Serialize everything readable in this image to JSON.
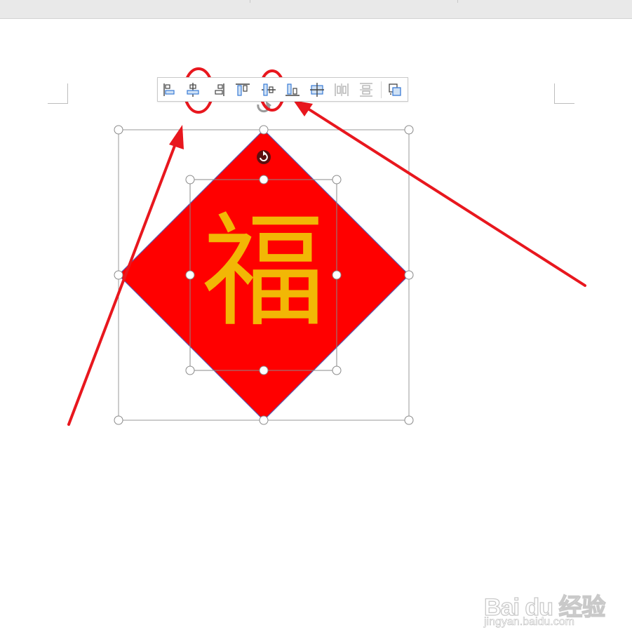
{
  "document": {
    "shape_text": "福",
    "shape_fill": "#ff0000",
    "shape_text_color": "#f2b705"
  },
  "toolbar": {
    "buttons": [
      {
        "name": "align-left-icon"
      },
      {
        "name": "align-center-horizontal-icon",
        "highlighted": true
      },
      {
        "name": "align-right-icon"
      },
      {
        "name": "align-top-icon"
      },
      {
        "name": "align-middle-vertical-icon",
        "highlighted": true
      },
      {
        "name": "align-bottom-icon"
      },
      {
        "name": "align-center-both-icon"
      },
      {
        "name": "distribute-horizontal-icon",
        "disabled": true
      },
      {
        "name": "distribute-vertical-icon",
        "disabled": true
      },
      {
        "name": "more-options-icon"
      }
    ]
  },
  "annotation": {
    "color": "#e8171e"
  },
  "watermark": {
    "logo": "Bai du 经验",
    "url": "jingyan.baidu.com"
  }
}
